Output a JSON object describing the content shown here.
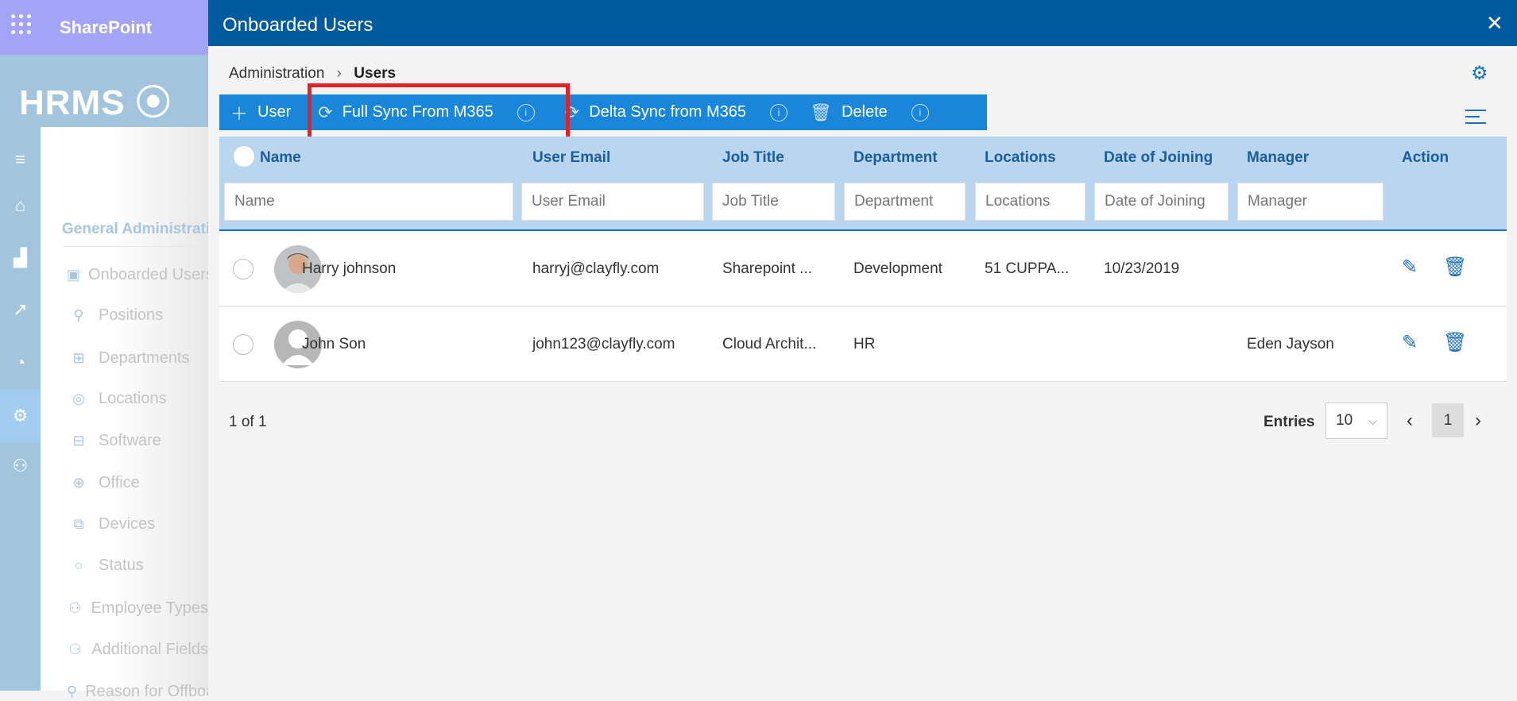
{
  "suite": {
    "title": "SharePoint",
    "logo": "HRMS"
  },
  "nav": {
    "heading": "General Administration",
    "items": [
      {
        "label": "Onboarded Users",
        "icon": "users-board-icon"
      },
      {
        "label": "Positions",
        "icon": "position-icon"
      },
      {
        "label": "Departments",
        "icon": "org-chart-icon"
      },
      {
        "label": "Locations",
        "icon": "location-icon"
      },
      {
        "label": "Software",
        "icon": "software-icon"
      },
      {
        "label": "Office",
        "icon": "globe-icon"
      },
      {
        "label": "Devices",
        "icon": "devices-icon"
      },
      {
        "label": "Status",
        "icon": "circle-icon"
      },
      {
        "label": "Employee Types",
        "icon": "people-icon"
      },
      {
        "label": "Additional Fields",
        "icon": "add-people-icon"
      },
      {
        "label": "Reason for Offboarding",
        "icon": "person-icon"
      }
    ]
  },
  "dialog": {
    "title": "Onboarded Users",
    "breadcrumb": {
      "parent": "Administration",
      "current": "Users"
    },
    "toolbar": {
      "add": "User",
      "full_sync": "Full Sync From M365",
      "delta_sync": "Delta Sync from M365",
      "delete": "Delete"
    },
    "columns": [
      "Name",
      "User Email",
      "Job Title",
      "Department",
      "Locations",
      "Date of Joining",
      "Manager",
      "Action"
    ],
    "filters": [
      "Name",
      "User Email",
      "Job Title",
      "Department",
      "Locations",
      "Date of Joining",
      "Manager"
    ],
    "rows": [
      {
        "name": "Harry johnson",
        "email": "harryj@clayfly.com",
        "job": "Sharepoint ...",
        "dept": "Development",
        "loc": "51 CUPPA...",
        "doj": "10/23/2019",
        "manager": ""
      },
      {
        "name": "John Son",
        "email": "john123@clayfly.com",
        "job": "Cloud Archit...",
        "dept": "HR",
        "loc": "",
        "doj": "",
        "manager": "Eden Jayson"
      }
    ],
    "footer": {
      "count": "1 of 1",
      "entries_label": "Entries",
      "page_size": "10",
      "page": "1"
    }
  },
  "colors": {
    "header": "#005a9e",
    "toolbar": "#1a86d9",
    "highlight": "#e32228"
  }
}
